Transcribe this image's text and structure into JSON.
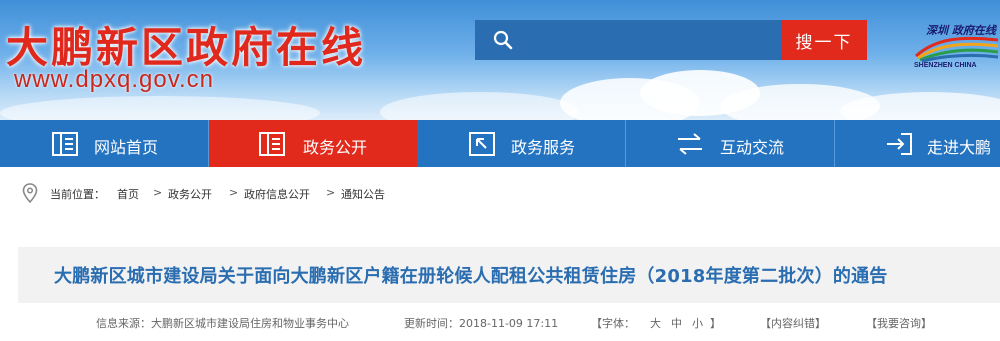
{
  "header": {
    "site_title": "大鹏新区政府在线",
    "site_url": "www.dpxq.gov.cn",
    "search": {
      "placeholder": "",
      "button_label": "搜一下"
    },
    "logo": {
      "text": "深圳 政府在线",
      "subtext": "SHENZHEN CHINA"
    }
  },
  "nav": {
    "items": [
      {
        "label": "网站首页",
        "icon": "home-doc-icon",
        "active": false
      },
      {
        "label": "政务公开",
        "icon": "public-doc-icon",
        "active": true
      },
      {
        "label": "政务服务",
        "icon": "service-icon",
        "active": false
      },
      {
        "label": "互动交流",
        "icon": "exchange-arrows-icon",
        "active": false
      },
      {
        "label": "走进大鹏",
        "icon": "enter-icon",
        "active": false
      }
    ]
  },
  "breadcrumb": {
    "label": "当前位置：",
    "items": [
      "首页",
      "政务公开",
      "政府信息公开",
      "通知公告"
    ],
    "separator": ">"
  },
  "article": {
    "title": "大鹏新区城市建设局关于面向大鹏新区户籍在册轮候人配租公共租赁住房（2018年度第二批次）的通告",
    "meta": {
      "source": "信息来源：大鹏新区城市建设局住房和物业事务中心",
      "updated": "更新时间：2018-11-09 17:11",
      "font_size_label": "【字体：",
      "font_large": "大",
      "font_medium": "中",
      "font_small": "小",
      "font_size_close": "】",
      "correction": "【内容纠错】",
      "feedback": "【我要咨询】"
    }
  },
  "colors": {
    "brand_red": "#e1291c",
    "nav_blue": "#2473c1",
    "search_blue": "#2a6db0",
    "title_blue": "#2a6db0"
  }
}
